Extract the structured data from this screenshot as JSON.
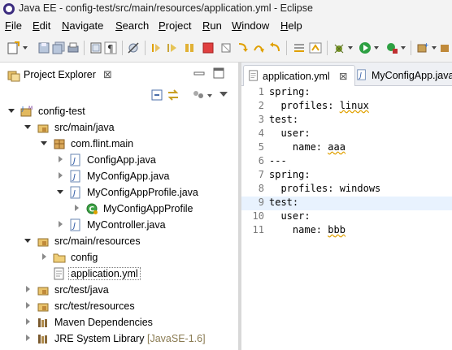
{
  "window": {
    "title": "Java EE - config-test/src/main/resources/application.yml - Eclipse"
  },
  "menu": [
    {
      "first": "F",
      "rest": "ile"
    },
    {
      "first": "E",
      "rest": "dit"
    },
    {
      "first": "N",
      "rest": "avigate"
    },
    {
      "first": "S",
      "rest": "earch"
    },
    {
      "first": "P",
      "rest": "roject"
    },
    {
      "first": "R",
      "rest": "un"
    },
    {
      "first": "W",
      "rest": "indow"
    },
    {
      "first": "H",
      "rest": "elp"
    }
  ],
  "project_explorer": {
    "tab_label": "Project Explorer",
    "close_glyph": "⊠",
    "tree": [
      {
        "label": "config-test",
        "icon": "project-icon"
      },
      {
        "label": "src/main/java",
        "icon": "source-folder-icon"
      },
      {
        "label": "com.flint.main",
        "icon": "package-icon"
      },
      {
        "label": "ConfigApp.java",
        "icon": "java-file-icon"
      },
      {
        "label": "MyConfigApp.java",
        "icon": "java-file-icon"
      },
      {
        "label": "MyConfigAppProfile.java",
        "icon": "java-file-icon"
      },
      {
        "label": "MyConfigAppProfile",
        "icon": "class-icon"
      },
      {
        "label": "MyController.java",
        "icon": "java-file-icon"
      },
      {
        "label": "src/main/resources",
        "icon": "source-folder-icon"
      },
      {
        "label": "config",
        "icon": "folder-icon"
      },
      {
        "label": "application.yml",
        "icon": "yml-file-icon"
      },
      {
        "label": "src/test/java",
        "icon": "source-folder-icon"
      },
      {
        "label": "src/test/resources",
        "icon": "source-folder-icon"
      },
      {
        "label": "Maven Dependencies",
        "icon": "library-icon"
      },
      {
        "label": "JRE System Library",
        "decoration": "[JavaSE-1.6]",
        "icon": "library-icon"
      }
    ]
  },
  "editor": {
    "tabs": [
      {
        "label": "application.yml",
        "close_glyph": "⊠",
        "active": true
      },
      {
        "label": "MyConfigApp.java",
        "active": false
      }
    ],
    "lines": [
      {
        "n": "1",
        "text": "spring:"
      },
      {
        "n": "2",
        "text": "  profiles: ",
        "sq": "linux"
      },
      {
        "n": "3",
        "text": "test:"
      },
      {
        "n": "4",
        "text": "  user:"
      },
      {
        "n": "5",
        "text": "    name: ",
        "sq": "aaa"
      },
      {
        "n": "6",
        "text": "---"
      },
      {
        "n": "7",
        "text": "spring:"
      },
      {
        "n": "8",
        "text": "  profiles: windows"
      },
      {
        "n": "9",
        "text": "test:"
      },
      {
        "n": "10",
        "text": "  user:"
      },
      {
        "n": "11",
        "text": "    name: ",
        "sq": "bbb"
      }
    ],
    "current_line": "9"
  }
}
